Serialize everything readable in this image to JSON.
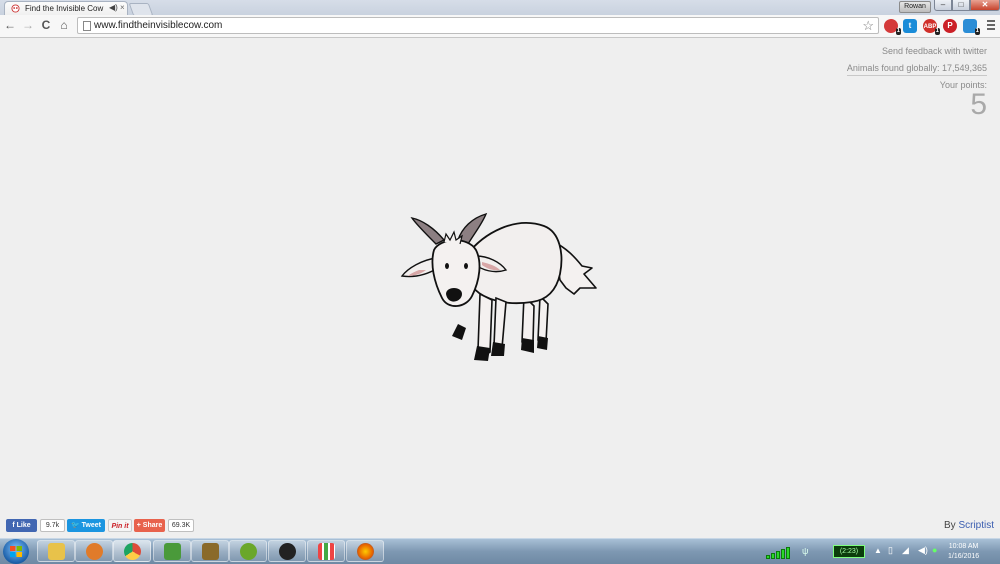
{
  "browser": {
    "tab_title": "Find the Invisible Cow",
    "tab_close": "×",
    "user_label": "Rowan",
    "url": "www.findtheinvisiblecow.com",
    "window_controls": {
      "minimize": "–",
      "maximize": "□",
      "close": "✕"
    },
    "nav": {
      "back": "←",
      "forward": "→",
      "reload": "C",
      "home": "⌂",
      "star": "☆"
    },
    "extensions": [
      {
        "icon": "stop-extension-icon",
        "color": "#d43a3a",
        "label": ""
      },
      {
        "icon": "twitter-extension-icon",
        "color": "#1a8cd8",
        "label": ""
      },
      {
        "icon": "adblock-extension-icon",
        "color": "#d0302a",
        "label": "ABP"
      },
      {
        "icon": "pinterest-extension-icon",
        "color": "#cb2027",
        "label": "P"
      },
      {
        "icon": "tag-extension-icon",
        "color": "#2b8dd6",
        "label": ""
      }
    ]
  },
  "page": {
    "feedback_link": "Send feedback with twitter",
    "animals_found": "Animals found globally: 17,549,365",
    "points_label": "Your points:",
    "points_value": "5",
    "animal": "goat"
  },
  "social": {
    "like_label": "Like",
    "like_count": "9.7k",
    "tweet_label": "Tweet",
    "pin_label": "Pin it",
    "share_label": "Share",
    "share_count": "69.3K"
  },
  "byline": {
    "prefix": "By",
    "author": "Scriptist"
  },
  "taskbar": {
    "apps": [
      {
        "icon": "file-explorer-icon",
        "color": "#e8c24a"
      },
      {
        "icon": "media-player-icon",
        "color": "#e07b2a"
      },
      {
        "icon": "chrome-icon",
        "color": "#dd4b39"
      },
      {
        "icon": "stock-chart-icon",
        "color": "#4a9a3a"
      },
      {
        "icon": "dosbox-icon",
        "color": "#8a6a2a"
      },
      {
        "icon": "hurricane-icon",
        "color": "#6aa72a"
      },
      {
        "icon": "sonos-icon",
        "color": "#222222"
      },
      {
        "icon": "app-grid-icon",
        "color": "#f5f5f5"
      },
      {
        "icon": "firefox-icon",
        "color": "#e66000"
      }
    ],
    "battery_time": "(2:23)",
    "clock_time": "10:08 AM",
    "clock_date": "1/16/2016"
  }
}
